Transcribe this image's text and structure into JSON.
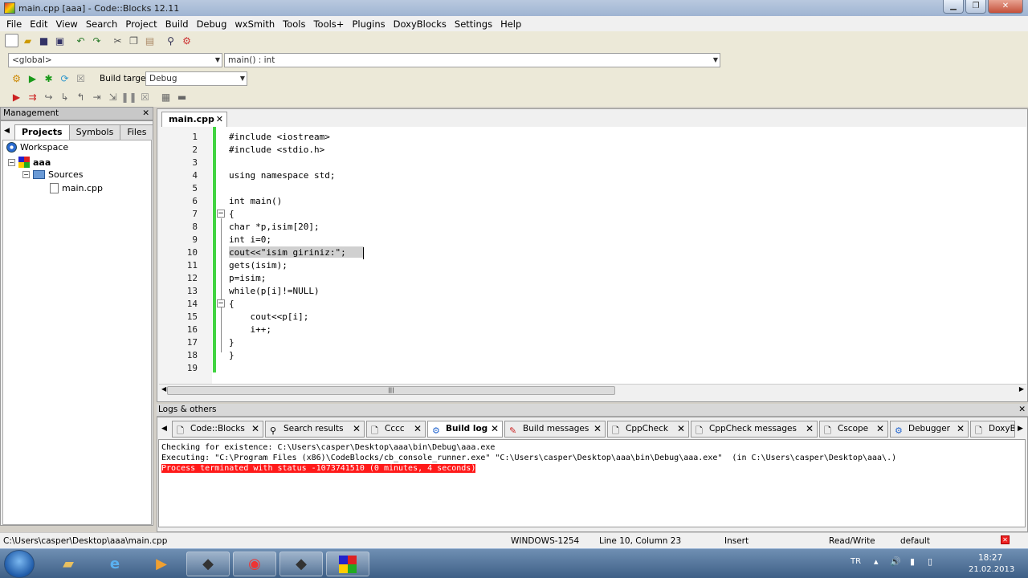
{
  "window": {
    "title": "main.cpp [aaa] - Code::Blocks 12.11",
    "min": "▁",
    "max": "❐",
    "close": "✕"
  },
  "menu": [
    "File",
    "Edit",
    "View",
    "Search",
    "Project",
    "Build",
    "Debug",
    "wxSmith",
    "Tools",
    "Tools+",
    "Plugins",
    "DoxyBlocks",
    "Settings",
    "Help"
  ],
  "scope": {
    "left": "<global>",
    "right": "main() : int"
  },
  "build": {
    "label": "Build target:",
    "target": "Debug"
  },
  "management": {
    "title": "Management",
    "close": "✕",
    "tabs": [
      "Projects",
      "Symbols",
      "Files"
    ],
    "prev": "◀",
    "next": "▶"
  },
  "tree": {
    "workspace": "Workspace",
    "project": "aaa",
    "folder": "Sources",
    "file": "main.cpp"
  },
  "editor_tab": {
    "label": "main.cpp",
    "close": "✕"
  },
  "code": {
    "line_numbers": [
      "1",
      "2",
      "3",
      "4",
      "5",
      "6",
      "7",
      "8",
      "9",
      "10",
      "11",
      "12",
      "13",
      "14",
      "15",
      "16",
      "17",
      "18",
      "19"
    ],
    "lines": [
      "#include <iostream>",
      "#include <stdio.h>",
      "",
      "using namespace std;",
      "",
      "int main()",
      "{",
      "char *p,isim[20];",
      "int i=0;",
      "cout<<\"isim giriniz:\";",
      "gets(isim);",
      "p=isim;",
      "while(p[i]!=NULL)",
      "{",
      "    cout<<p[i];",
      "    i++;",
      "}",
      "}",
      ""
    ]
  },
  "logs": {
    "title": "Logs & others",
    "close": "✕",
    "tabs": [
      {
        "label": "Code::Blocks",
        "icon": "doc-icon"
      },
      {
        "label": "Search results",
        "icon": "search-icon"
      },
      {
        "label": "Cccc",
        "icon": "doc-icon"
      },
      {
        "label": "Build log",
        "icon": "gear-icon"
      },
      {
        "label": "Build messages",
        "icon": "pin-icon"
      },
      {
        "label": "CppCheck",
        "icon": "doc-icon"
      },
      {
        "label": "CppCheck messages",
        "icon": "doc-icon"
      },
      {
        "label": "Cscope",
        "icon": "doc-icon"
      },
      {
        "label": "Debugger",
        "icon": "gear-icon"
      },
      {
        "label": "DoxyB",
        "icon": "doc-icon"
      }
    ],
    "lines": [
      "Checking for existence: C:\\Users\\casper\\Desktop\\aaa\\bin\\Debug\\aaa.exe",
      "Executing: \"C:\\Program Files (x86)\\CodeBlocks/cb_console_runner.exe\" \"C:\\Users\\casper\\Desktop\\aaa\\bin\\Debug\\aaa.exe\"  (in C:\\Users\\casper\\Desktop\\aaa\\.)",
      "Process terminated with status -1073741510 (0 minutes, 4 seconds)"
    ],
    "error_color": "#ff1a1a"
  },
  "status": {
    "path": "C:\\Users\\casper\\Desktop\\aaa\\main.cpp",
    "encoding": "WINDOWS-1254",
    "position": "Line 10, Column 23",
    "mode": "Insert",
    "access": "Read/Write",
    "profile": "default"
  },
  "tray": {
    "lang": "TR",
    "time": "18:27",
    "date": "21.02.2013"
  },
  "colors": {
    "change_bar": "#41d441",
    "keyword": "#00007f",
    "preprocessor": "#007f00",
    "string": "#0000ff"
  }
}
